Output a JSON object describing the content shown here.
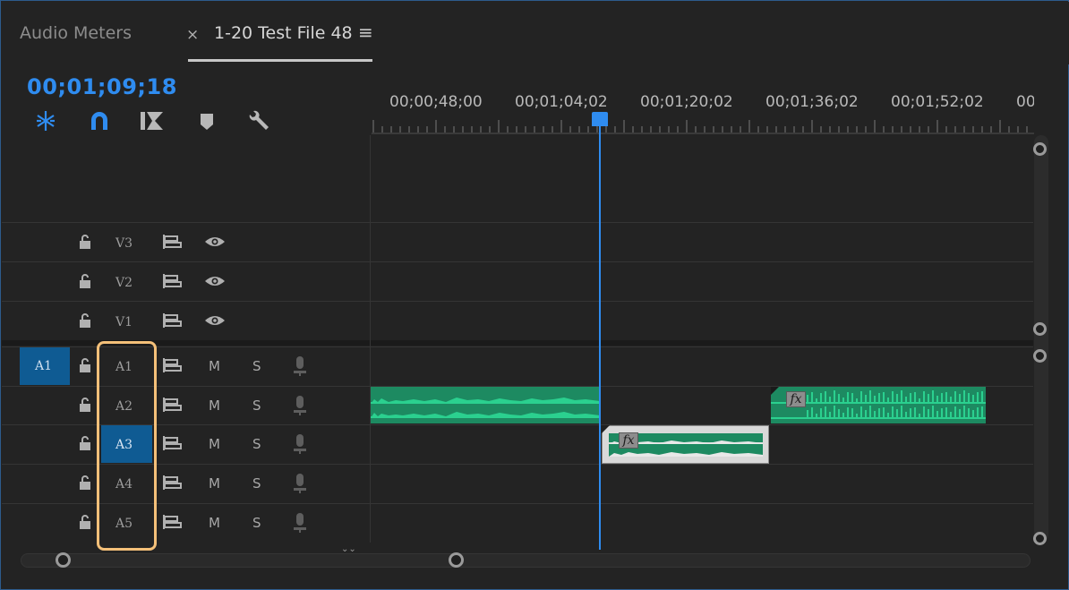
{
  "tabs": {
    "audio_meters": "Audio Meters",
    "close": "×",
    "sequence": "1-20 Test File 48",
    "menu": "≡"
  },
  "timecode": "00;01;09;18",
  "ruler_labels": [
    "00;00;48;00",
    "00;01;04;02",
    "00;01;20;02",
    "00;01;36;02",
    "00;01;52;02",
    "00"
  ],
  "toolbar_icons": [
    "snap-icon",
    "magnet-icon",
    "linked-selection-icon",
    "marker-icon",
    "wrench-icon"
  ],
  "video_tracks": [
    {
      "label": "V3"
    },
    {
      "label": "V2"
    },
    {
      "label": "V1"
    }
  ],
  "audio_tracks": [
    {
      "label": "A1",
      "mute": "M",
      "solo": "S",
      "source": "A1",
      "selected": false
    },
    {
      "label": "A2",
      "mute": "M",
      "solo": "S",
      "source": "",
      "selected": false
    },
    {
      "label": "A3",
      "mute": "M",
      "solo": "S",
      "source": "",
      "selected": true
    },
    {
      "label": "A4",
      "mute": "M",
      "solo": "S",
      "source": "",
      "selected": false
    },
    {
      "label": "A5",
      "mute": "M",
      "solo": "S",
      "source": "",
      "selected": false
    }
  ],
  "clips": {
    "fx_label": "fx"
  },
  "colors": {
    "accent": "#2f8cf0",
    "clip_green": "#1d8a61",
    "highlight": "#f4c079"
  }
}
